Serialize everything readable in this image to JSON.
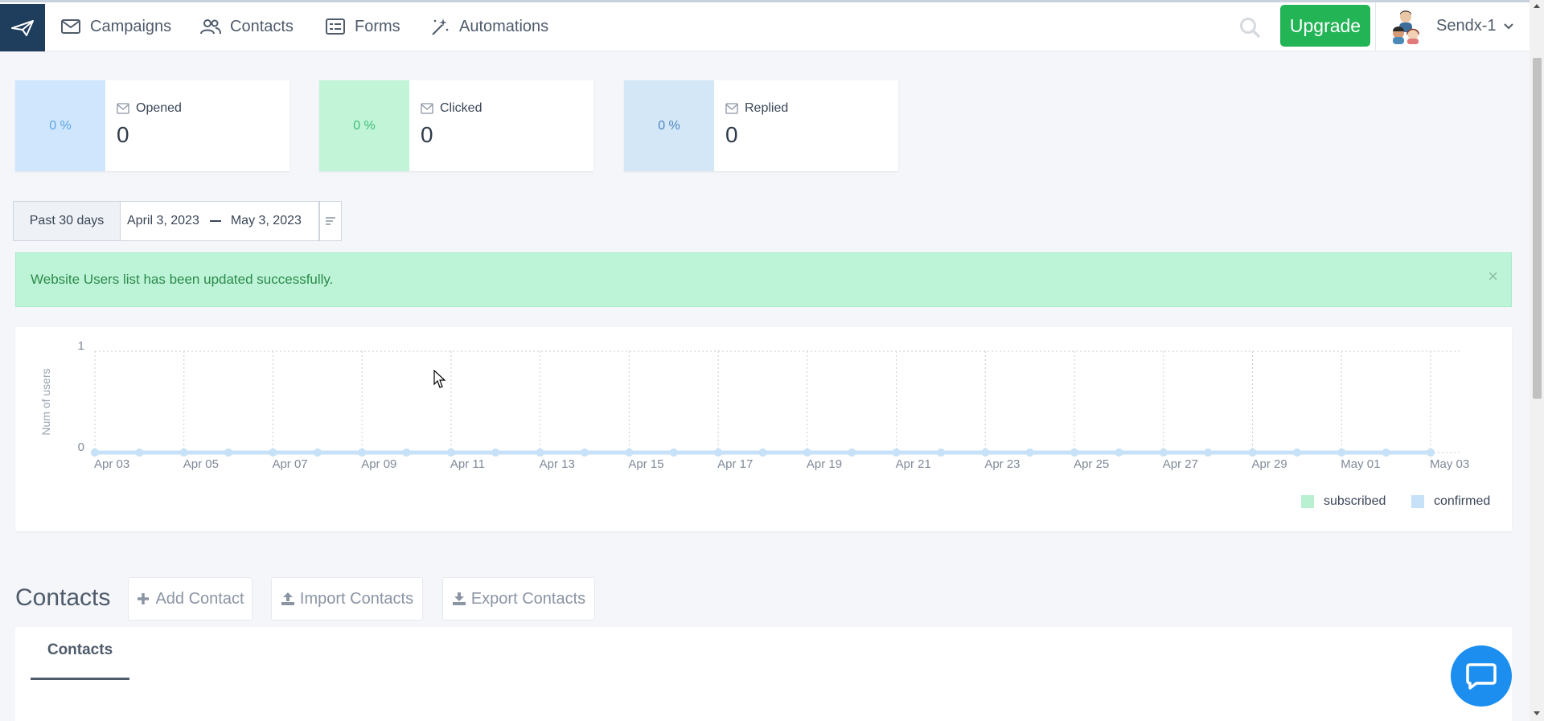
{
  "nav": {
    "items": [
      {
        "label": "Campaigns",
        "icon": "envelope-icon"
      },
      {
        "label": "Contacts",
        "icon": "users-icon"
      },
      {
        "label": "Forms",
        "icon": "form-icon"
      },
      {
        "label": "Automations",
        "icon": "magic-wand-icon"
      }
    ],
    "upgrade_label": "Upgrade",
    "account_name": "Sendx-1"
  },
  "stats": [
    {
      "percent": "0 %",
      "label": "Opened",
      "value": "0",
      "color": "#cfe6fd",
      "text_color": "#5aa4e6"
    },
    {
      "percent": "0 %",
      "label": "Clicked",
      "value": "0",
      "color": "#c2f4d8",
      "text_color": "#3fbf78"
    },
    {
      "percent": "0 %",
      "label": "Replied",
      "value": "0",
      "color": "#d3e7f7",
      "text_color": "#4f86c2"
    }
  ],
  "date_range": {
    "preset": "Past 30 days",
    "start": "April 3, 2023",
    "end": "May 3, 2023"
  },
  "alert": {
    "message": "Website Users list has been updated successfully.",
    "close": "×"
  },
  "chart_data": {
    "type": "line",
    "ylabel": "Num of users",
    "ylim": [
      0,
      1
    ],
    "yticks": [
      "0",
      "1"
    ],
    "x": [
      "Apr 03",
      "Apr 04",
      "Apr 05",
      "Apr 06",
      "Apr 07",
      "Apr 08",
      "Apr 09",
      "Apr 10",
      "Apr 11",
      "Apr 12",
      "Apr 13",
      "Apr 14",
      "Apr 15",
      "Apr 16",
      "Apr 17",
      "Apr 18",
      "Apr 19",
      "Apr 20",
      "Apr 21",
      "Apr 22",
      "Apr 23",
      "Apr 24",
      "Apr 25",
      "Apr 26",
      "Apr 27",
      "Apr 28",
      "Apr 29",
      "Apr 30",
      "May 01",
      "May 02",
      "May 03"
    ],
    "xtick_labels": [
      "Apr 03",
      "Apr 05",
      "Apr 07",
      "Apr 09",
      "Apr 11",
      "Apr 13",
      "Apr 15",
      "Apr 17",
      "Apr 19",
      "Apr 21",
      "Apr 23",
      "Apr 25",
      "Apr 27",
      "Apr 29",
      "May 01",
      "May 03"
    ],
    "series": [
      {
        "name": "subscribed",
        "color": "#b9f0d2",
        "values": [
          0,
          0,
          0,
          0,
          0,
          0,
          0,
          0,
          0,
          0,
          0,
          0,
          0,
          0,
          0,
          0,
          0,
          0,
          0,
          0,
          0,
          0,
          0,
          0,
          0,
          0,
          0,
          0,
          0,
          0,
          0
        ]
      },
      {
        "name": "confirmed",
        "color": "#c7e1f8",
        "values": [
          0,
          0,
          0,
          0,
          0,
          0,
          0,
          0,
          0,
          0,
          0,
          0,
          0,
          0,
          0,
          0,
          0,
          0,
          0,
          0,
          0,
          0,
          0,
          0,
          0,
          0,
          0,
          0,
          0,
          0,
          0
        ]
      }
    ],
    "grid": true,
    "legend": "bottom-right"
  },
  "contacts": {
    "title": "Contacts",
    "add_label": "Add Contact",
    "import_label": "Import Contacts",
    "export_label": "Export Contacts",
    "tab_label": "Contacts"
  }
}
